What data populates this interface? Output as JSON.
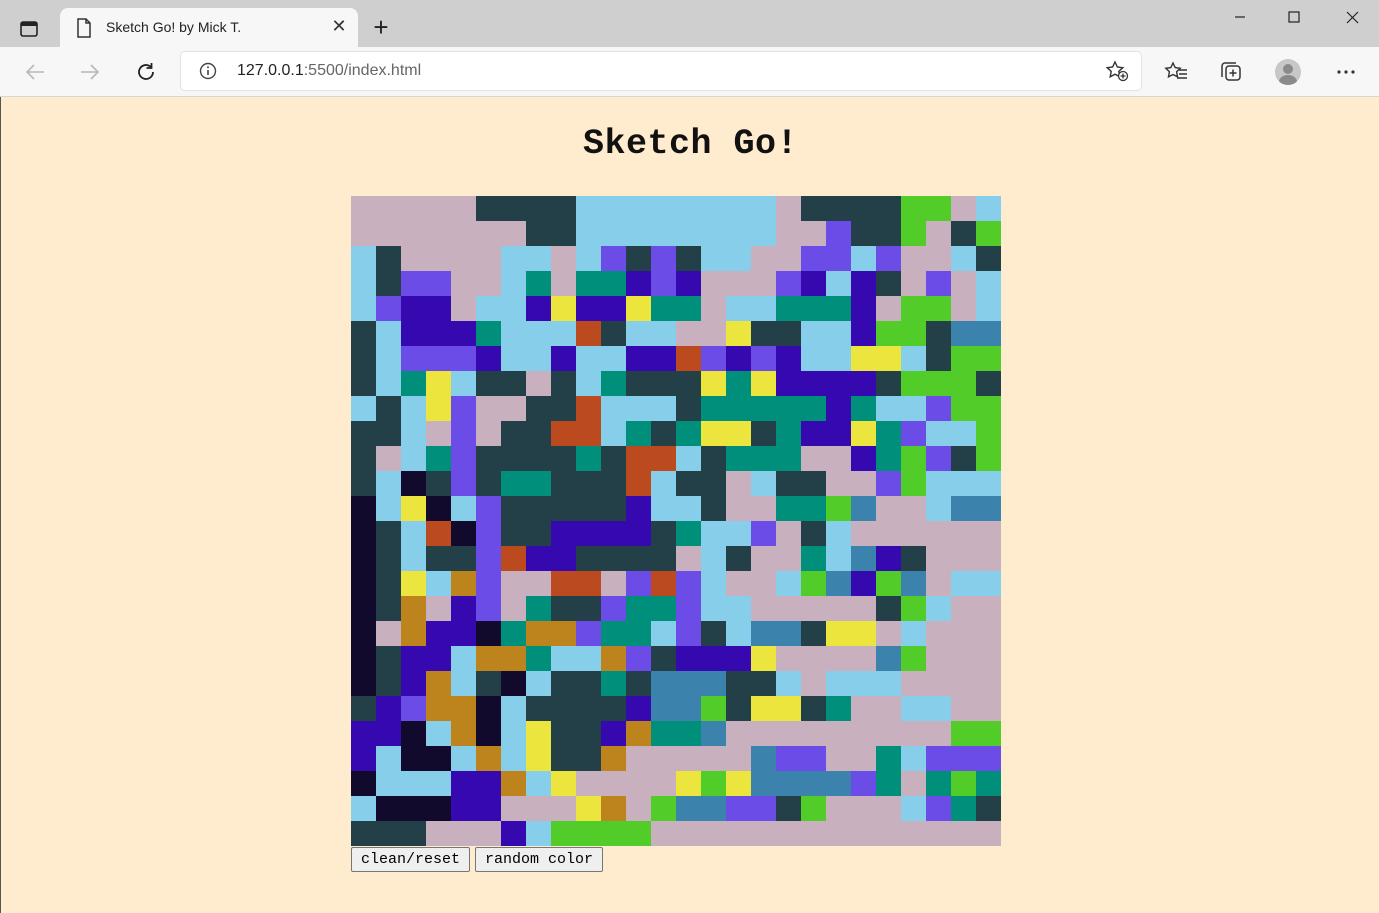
{
  "browser": {
    "tab": {
      "title": "Sketch Go! by Mick T.",
      "icon": "document-icon",
      "close_glyph": "✕"
    },
    "new_tab_glyph": "+",
    "url": {
      "host": "127.0.0.1",
      "rest": ":5500/index.html"
    }
  },
  "page": {
    "title": "Sketch Go!",
    "buttons": {
      "clean": "clean/reset",
      "random": "random color"
    }
  },
  "sketch": {
    "palette": {
      "p": "#c8b0bf",
      "d": "#234048",
      "l": "#87ceeb",
      "g": "#52cc28",
      "v": "#6b4ce6",
      "i": "#3508b0",
      "t": "#008f7a",
      "y": "#ece53d",
      "r": "#bb4a1e",
      "k": "#120a2d",
      "b": "#3b82ad",
      "o": "#bd841e"
    },
    "rows": [
      "pppppddddllllllllpddddggpl",
      "pppppppddllllllllppvddgpdg",
      "ldppppllplvdvdllppvvlvppld",
      "ldvvppltpttivipppvilidpvpl",
      "lviiplliyiiyttplltttipggpl",
      "dliiitlllrdllppyddlliggdbb",
      "dlvvvillilliirvivillyyldgggb",
      "dltylddpdltdddytyiiiidgggd",
      "ldlyvppddrllldtttttitllvgg",
      "ddlpvpddrrltdtyydtiiytvllg",
      "dpltvddddtdrrldtttppitgvdg",
      "dlkdvdttdddrlddplddppvgll",
      "klyklvdddddilldppttgbpplbb",
      "kdlrkvddiiiidtllvpdlppppppb",
      "kdlddvriiddddpldpptlbidpppp",
      "kdylovpprrpvrvlpplgbigbpl",
      "kdopivptddvttvllpppppdglp",
      "kpoiiktoovttlvdlbbdyyplpp",
      "kdiilootllovdiiiyppppbgp",
      "kdioldklddtdbbbddlplllpp",
      "divooklddddibbgdyydtppllpp",
      "iikloklyddiottbpppppppppg",
      "ilkklolyddopppppbvvpptlv",
      "kllliiolyppppygybbbbvtptgt",
      "lkkkiipppyopgbbvvdgppplvtd",
      "dddpppilggggpppppppppppp"
    ]
  }
}
